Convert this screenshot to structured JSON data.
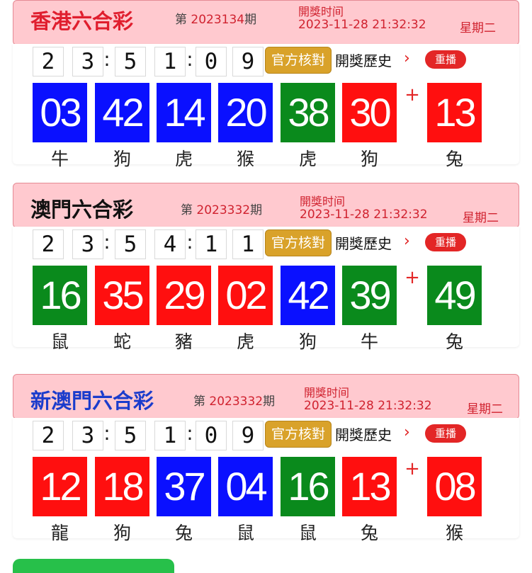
{
  "colors": {
    "red": "#ff0f0f",
    "blue": "#0a10ff",
    "green": "#0a8a1c",
    "header_bg": "#ffc9cf",
    "accent": "#d0222f"
  },
  "panels": [
    {
      "title": "香港六合彩",
      "title_color": "#e01e2e",
      "issue_prefix": "第",
      "issue_number": "2023134",
      "issue_suffix": "期",
      "open_label": "開獎时间",
      "open_time": "2023-11-28 21:32:32",
      "weekday": "星期二",
      "countdown": [
        "2",
        "3",
        "5",
        "1",
        "0",
        "9"
      ],
      "verify_label": "官方核對",
      "history_label": "開獎歷史",
      "replay_label": "重播",
      "balls": [
        {
          "num": "03",
          "zodiac": "牛",
          "color": "blue"
        },
        {
          "num": "42",
          "zodiac": "狗",
          "color": "blue"
        },
        {
          "num": "14",
          "zodiac": "虎",
          "color": "blue"
        },
        {
          "num": "20",
          "zodiac": "猴",
          "color": "blue"
        },
        {
          "num": "38",
          "zodiac": "虎",
          "color": "green"
        },
        {
          "num": "30",
          "zodiac": "狗",
          "color": "red"
        }
      ],
      "special": {
        "num": "13",
        "zodiac": "兔",
        "color": "red"
      }
    },
    {
      "title": "澳門六合彩",
      "title_color": "#111111",
      "issue_prefix": "第",
      "issue_number": "2023332",
      "issue_suffix": "期",
      "open_label": "開獎时间",
      "open_time": "2023-11-28 21:32:32",
      "weekday": "星期二",
      "countdown": [
        "2",
        "3",
        "5",
        "4",
        "1",
        "1"
      ],
      "verify_label": "官方核對",
      "history_label": "開獎歷史",
      "replay_label": "重播",
      "balls": [
        {
          "num": "16",
          "zodiac": "鼠",
          "color": "green"
        },
        {
          "num": "35",
          "zodiac": "蛇",
          "color": "red"
        },
        {
          "num": "29",
          "zodiac": "豬",
          "color": "red"
        },
        {
          "num": "02",
          "zodiac": "虎",
          "color": "red"
        },
        {
          "num": "42",
          "zodiac": "狗",
          "color": "blue"
        },
        {
          "num": "39",
          "zodiac": "牛",
          "color": "green"
        }
      ],
      "special": {
        "num": "49",
        "zodiac": "兔",
        "color": "green"
      }
    },
    {
      "title": "新澳門六合彩",
      "title_color": "#1b3ccc",
      "issue_prefix": "第",
      "issue_number": "2023332",
      "issue_suffix": "期",
      "open_label": "開獎时间",
      "open_time": "2023-11-28 21:32:32",
      "weekday": "星期二",
      "countdown": [
        "2",
        "3",
        "5",
        "1",
        "0",
        "9"
      ],
      "verify_label": "官方核對",
      "history_label": "開獎歷史",
      "replay_label": "重播",
      "balls": [
        {
          "num": "12",
          "zodiac": "龍",
          "color": "red"
        },
        {
          "num": "18",
          "zodiac": "狗",
          "color": "red"
        },
        {
          "num": "37",
          "zodiac": "兔",
          "color": "blue"
        },
        {
          "num": "04",
          "zodiac": "鼠",
          "color": "blue"
        },
        {
          "num": "16",
          "zodiac": "鼠",
          "color": "green"
        },
        {
          "num": "13",
          "zodiac": "兔",
          "color": "red"
        }
      ],
      "special": {
        "num": "08",
        "zodiac": "猴",
        "color": "red"
      }
    }
  ]
}
